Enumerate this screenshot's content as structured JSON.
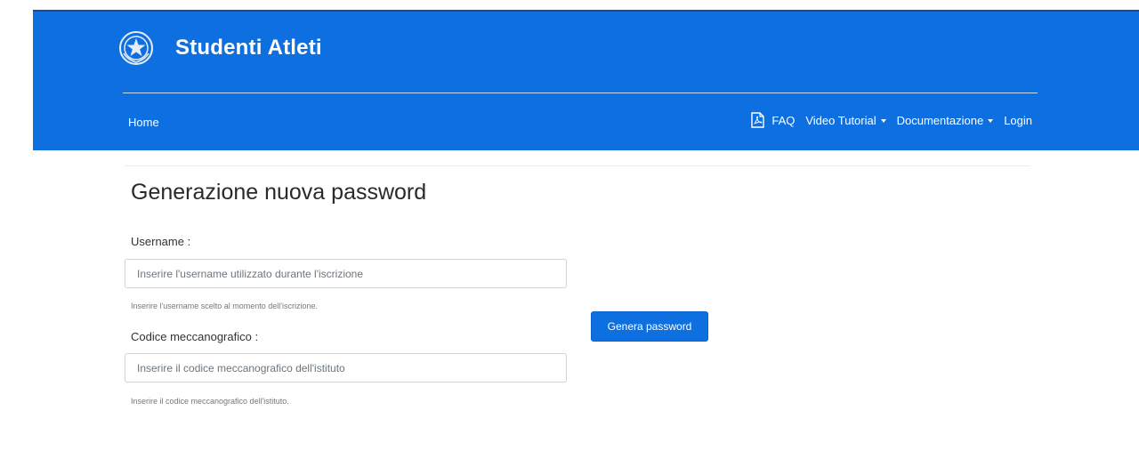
{
  "header": {
    "site_title": "Studenti Atleti",
    "emblem_icon": "italian-republic-emblem-icon",
    "brand_color": "#0d6fe0"
  },
  "nav": {
    "home": "Home",
    "faq": "FAQ",
    "faq_icon": "pdf-file-icon",
    "video_tutorial": "Video Tutorial",
    "documentazione": "Documentazione",
    "login": "Login"
  },
  "form": {
    "title": "Generazione nuova password",
    "username": {
      "label": "Username :",
      "placeholder": "Inserire l'username utilizzato durante l'iscrizione",
      "value": "",
      "help": "Inserire l'username scelto al momento dell'iscrizione."
    },
    "codice": {
      "label": "Codice meccanografico :",
      "placeholder": "Inserire il codice meccanografico dell'istituto",
      "value": "",
      "help": "Inserire il codice meccanografico dell'istituto."
    },
    "submit_label": "Genera password"
  }
}
